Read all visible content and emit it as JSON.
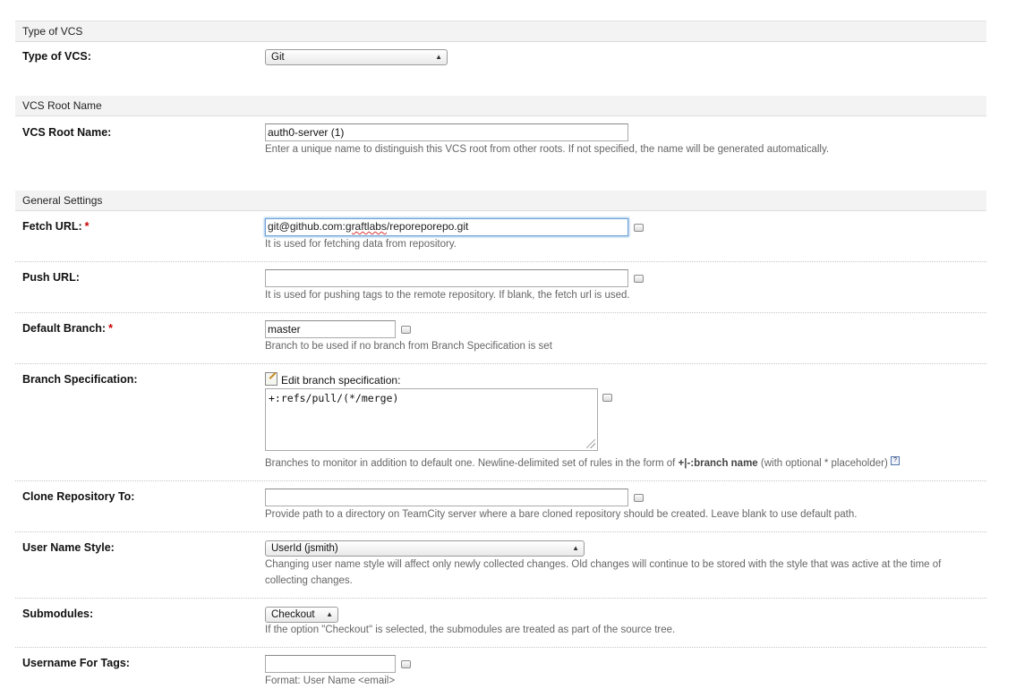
{
  "sections": {
    "type_vcs": "Type of VCS",
    "root_name": "VCS Root Name",
    "general": "General Settings"
  },
  "type_vcs": {
    "label": "Type of VCS:",
    "selected": "Git"
  },
  "root_name": {
    "label": "VCS Root Name:",
    "value": "auth0-server (1)",
    "note": "Enter a unique name to distinguish this VCS root from other roots. If not specified, the name will be generated automatically."
  },
  "fetch_url": {
    "label": "Fetch URL:",
    "required": "*",
    "value_prefix": "git@github.com:",
    "value_misspelled": "graftlabs",
    "value_suffix": "/reporeporepo.git",
    "note": "It is used for fetching data from repository."
  },
  "push_url": {
    "label": "Push URL:",
    "value": "",
    "note": "It is used for pushing tags to the remote repository. If blank, the fetch url is used."
  },
  "default_branch": {
    "label": "Default Branch:",
    "required": "*",
    "value": "master",
    "note": "Branch to be used if no branch from Branch Specification is set"
  },
  "branch_spec": {
    "label": "Branch Specification:",
    "edit_label": "Edit branch specification:",
    "value": "+:refs/pull/(*/merge)",
    "note_pre": "Branches to monitor in addition to default one. Newline-delimited set of rules in the form of ",
    "note_bold": "+|-:branch name",
    "note_post": " (with optional * placeholder)",
    "help_glyph": "?"
  },
  "clone_to": {
    "label": "Clone Repository To:",
    "value": "",
    "note": "Provide path to a directory on TeamCity server where a bare cloned repository should be created. Leave blank to use default path."
  },
  "user_name_style": {
    "label": "User Name Style:",
    "selected": "UserId (jsmith)",
    "note_line1": "Changing user name style will affect only newly collected changes. Old changes will continue to be stored with the style that was active at the time of",
    "note_line2": "collecting changes."
  },
  "submodules": {
    "label": "Submodules:",
    "selected": "Checkout",
    "note": "If the option \"Checkout\" is selected, the submodules are treated as part of the source tree."
  },
  "username_tags": {
    "label": "Username For Tags:",
    "value": "",
    "note": "Format: User Name <email>"
  },
  "icons": {
    "select_arrows": "updown-arrows-icon",
    "field_toggle": "field-toggle-icon",
    "edit": "edit-pencil-icon",
    "help": "help-icon",
    "resize": "resize-grip-icon"
  }
}
